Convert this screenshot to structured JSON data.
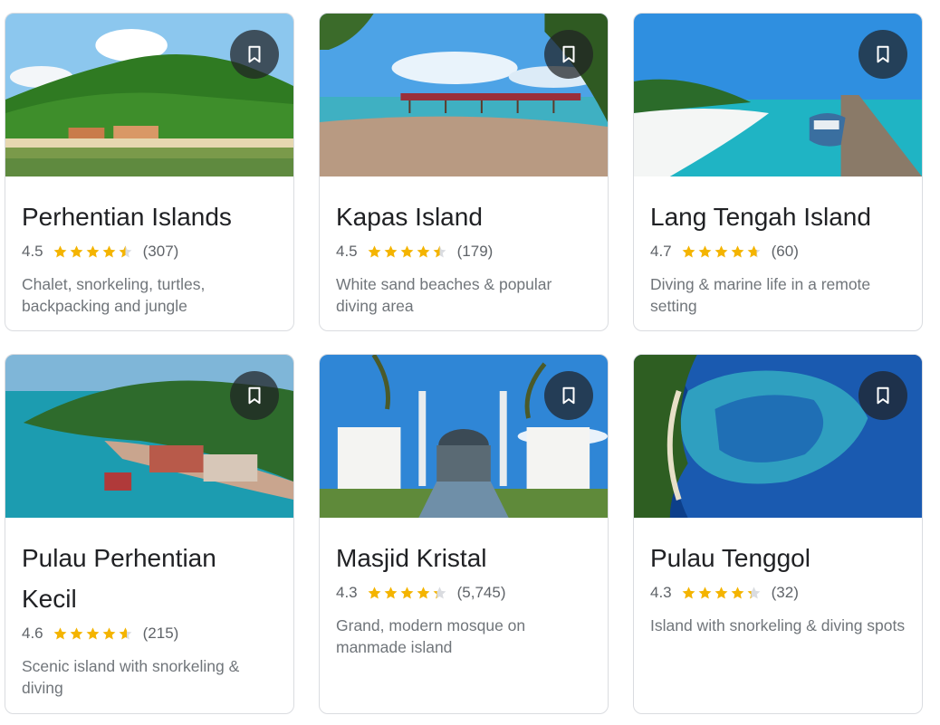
{
  "cards": [
    {
      "title": "Perhentian Islands",
      "rating": "4.5",
      "rating_value": 4.5,
      "reviews": "(307)",
      "description": "Chalet, snorkeling, turtles, backpacking and jungle",
      "save_icon": "bookmark-icon"
    },
    {
      "title": "Kapas Island",
      "rating": "4.5",
      "rating_value": 4.5,
      "reviews": "(179)",
      "description": "White sand beaches & popular diving area",
      "save_icon": "bookmark-icon"
    },
    {
      "title": "Lang Tengah Island",
      "rating": "4.7",
      "rating_value": 4.7,
      "reviews": "(60)",
      "description": "Diving & marine life in a remote setting",
      "save_icon": "bookmark-icon"
    },
    {
      "title": "Pulau Perhentian Kecil",
      "rating": "4.6",
      "rating_value": 4.6,
      "reviews": "(215)",
      "description": "Scenic island with snorkeling & diving",
      "save_icon": "bookmark-icon"
    },
    {
      "title": "Masjid Kristal",
      "rating": "4.3",
      "rating_value": 4.3,
      "reviews": "(5,745)",
      "description": "Grand, modern mosque on manmade island",
      "save_icon": "bookmark-icon"
    },
    {
      "title": "Pulau Tenggol",
      "rating": "4.3",
      "rating_value": 4.3,
      "reviews": "(32)",
      "description": "Island with snorkeling & diving spots",
      "save_icon": "bookmark-icon"
    }
  ],
  "colors": {
    "star": "#f4b400",
    "star_empty": "#dadce0",
    "title": "#202124",
    "meta": "#70757a"
  }
}
